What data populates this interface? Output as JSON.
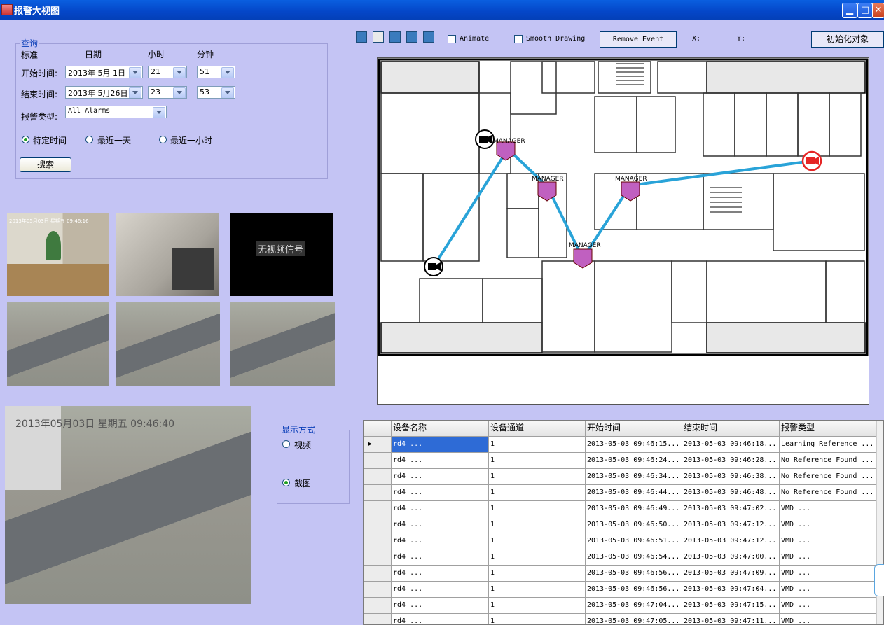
{
  "window": {
    "title": "报警大视图",
    "min": "▁",
    "max": "□",
    "close": "✕"
  },
  "query": {
    "legend": "查询",
    "col_criteria": "标准",
    "col_date": "日期",
    "col_hour": "小时",
    "col_minute": "分钟",
    "start_label": "开始时间:",
    "start_date": "2013年 5月 1日",
    "start_hour": "21",
    "start_minute": "51",
    "end_label": "结束时间:",
    "end_date": "2013年 5月26日",
    "end_hour": "23",
    "end_minute": "53",
    "type_label": "报警类型:",
    "type_value": "All Alarms",
    "radio_specific": "特定时间",
    "radio_day": "最近一天",
    "radio_hour": "最近一小时",
    "search": "搜索"
  },
  "toolbar": {
    "animate": "Animate",
    "smooth": "Smooth Drawing",
    "remove": "Remove Event",
    "x_label": "X:",
    "y_label": "Y:",
    "init": "初始化对象"
  },
  "map": {
    "manager": "MANAGER"
  },
  "thumbs": {
    "overlay1": "2013年05月03日 星期五 09:46:16",
    "no_signal": "无视频信号",
    "big_overlay": "2013年05月03日 星期五 09:46:40"
  },
  "display": {
    "legend": "显示方式",
    "video": "视频",
    "snapshot": "截图"
  },
  "grid": {
    "headers": [
      "设备名称",
      "设备通道",
      "开始时间",
      "结束时间",
      "报警类型"
    ],
    "rows": [
      [
        "rd4 ...",
        "1",
        "2013-05-03 09:46:15...",
        "2013-05-03 09:46:18...",
        "Learning Reference ..."
      ],
      [
        "rd4 ...",
        "1",
        "2013-05-03 09:46:24...",
        "2013-05-03 09:46:28...",
        "No Reference Found ..."
      ],
      [
        "rd4 ...",
        "1",
        "2013-05-03 09:46:34...",
        "2013-05-03 09:46:38...",
        "No Reference Found ..."
      ],
      [
        "rd4 ...",
        "1",
        "2013-05-03 09:46:44...",
        "2013-05-03 09:46:48...",
        "No Reference Found ..."
      ],
      [
        "rd4 ...",
        "1",
        "2013-05-03 09:46:49...",
        "2013-05-03 09:47:02...",
        "VMD ..."
      ],
      [
        "rd4 ...",
        "1",
        "2013-05-03 09:46:50...",
        "2013-05-03 09:47:12...",
        "VMD ..."
      ],
      [
        "rd4 ...",
        "1",
        "2013-05-03 09:46:51...",
        "2013-05-03 09:47:12...",
        "VMD ..."
      ],
      [
        "rd4 ...",
        "1",
        "2013-05-03 09:46:54...",
        "2013-05-03 09:47:00...",
        "VMD ..."
      ],
      [
        "rd4 ...",
        "1",
        "2013-05-03 09:46:56...",
        "2013-05-03 09:47:09...",
        "VMD ..."
      ],
      [
        "rd4 ...",
        "1",
        "2013-05-03 09:46:56...",
        "2013-05-03 09:47:04...",
        "VMD ..."
      ],
      [
        "rd4 ...",
        "1",
        "2013-05-03 09:47:04...",
        "2013-05-03 09:47:15...",
        "VMD ..."
      ],
      [
        "rd4 ...",
        "1",
        "2013-05-03 09:47:05...",
        "2013-05-03 09:47:11...",
        "VMD ..."
      ]
    ]
  }
}
